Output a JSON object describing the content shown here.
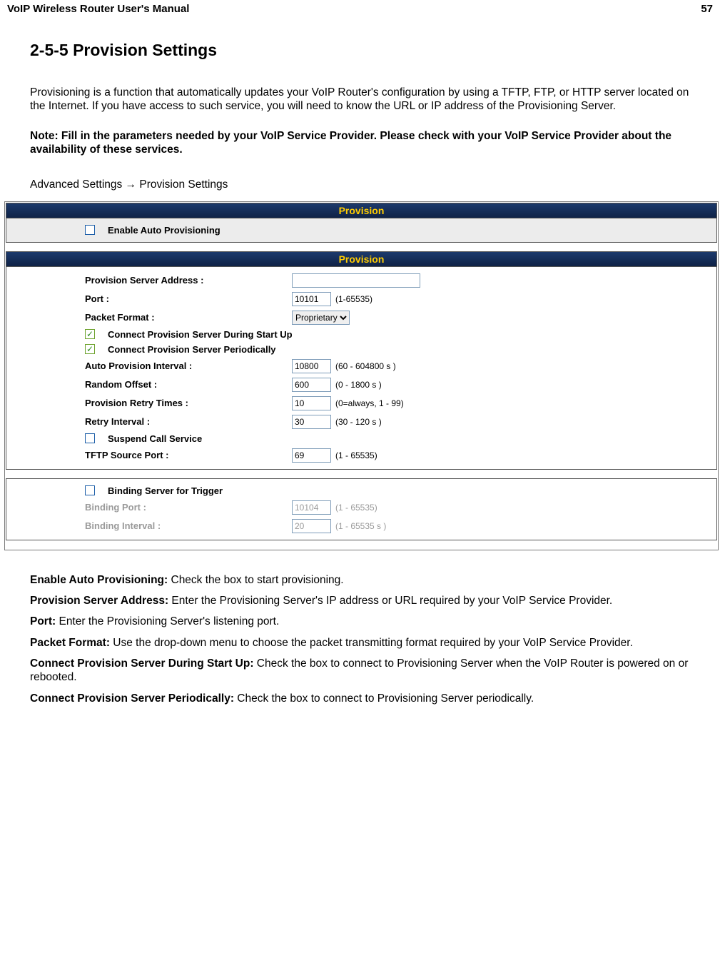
{
  "header": {
    "title": "VoIP Wireless Router User's Manual",
    "page_number": "57"
  },
  "section": {
    "title": "2-5-5 Provision Settings",
    "intro": "Provisioning is a function that automatically updates your VoIP Router's configuration by using a TFTP, FTP, or HTTP server located on the Internet. If you have access to such service, you will need to know the URL or IP address of the Provisioning Server.",
    "note": "Note: Fill in the parameters needed by your VoIP Service Provider. Please check with your VoIP Service Provider about the availability of these services.",
    "breadcrumb": "Advanced Settings  →   Provision Settings"
  },
  "panel1": {
    "title": "Provision",
    "enable_label": "Enable Auto Provisioning"
  },
  "panel2": {
    "title": "Provision",
    "rows": {
      "server_addr_label": "Provision Server Address :",
      "server_addr_value": "",
      "port_label": "Port :",
      "port_value": "10101",
      "port_hint": "(1-65535)",
      "packet_format_label": "Packet Format :",
      "packet_format_value": "Proprietary",
      "connect_startup_label": "Connect Provision Server During Start Up",
      "connect_periodic_label": "Connect Provision Server Periodically",
      "auto_interval_label": "Auto Provision Interval :",
      "auto_interval_value": "10800",
      "auto_interval_hint": "(60 - 604800 s )",
      "random_offset_label": "Random Offset :",
      "random_offset_value": "600",
      "random_offset_hint": "(0 - 1800 s )",
      "retry_times_label": "Provision Retry Times :",
      "retry_times_value": "10",
      "retry_times_hint": "(0=always, 1 - 99)",
      "retry_interval_label": "Retry Interval :",
      "retry_interval_value": "30",
      "retry_interval_hint": "(30 - 120 s )",
      "suspend_label": "Suspend Call Service",
      "tftp_port_label": "TFTP Source Port :",
      "tftp_port_value": "69",
      "tftp_port_hint": "(1 - 65535)"
    }
  },
  "panel3": {
    "binding_trigger_label": "Binding Server for Trigger",
    "binding_port_label": "Binding Port :",
    "binding_port_value": "10104",
    "binding_port_hint": "(1 - 65535)",
    "binding_interval_label": "Binding Interval :",
    "binding_interval_value": "20",
    "binding_interval_hint": "(1 - 65535 s )"
  },
  "definitions": [
    {
      "term": "Enable Auto Provisioning:",
      "desc": " Check the box to start provisioning."
    },
    {
      "term": "Provision Server Address:",
      "desc": " Enter the Provisioning Server's IP address or URL required by your VoIP Service Provider."
    },
    {
      "term": "Port:",
      "desc": " Enter the Provisioning Server's listening port."
    },
    {
      "term": "Packet Format:",
      "desc": " Use the drop-down menu to choose the packet transmitting format required by your VoIP Service Provider."
    },
    {
      "term": "Connect Provision Server During Start Up:",
      "desc": " Check the box to connect to Provisioning Server when the VoIP Router is powered on or rebooted."
    },
    {
      "term": "Connect Provision Server Periodically:",
      "desc": " Check the box to connect to Provisioning Server periodically."
    }
  ]
}
